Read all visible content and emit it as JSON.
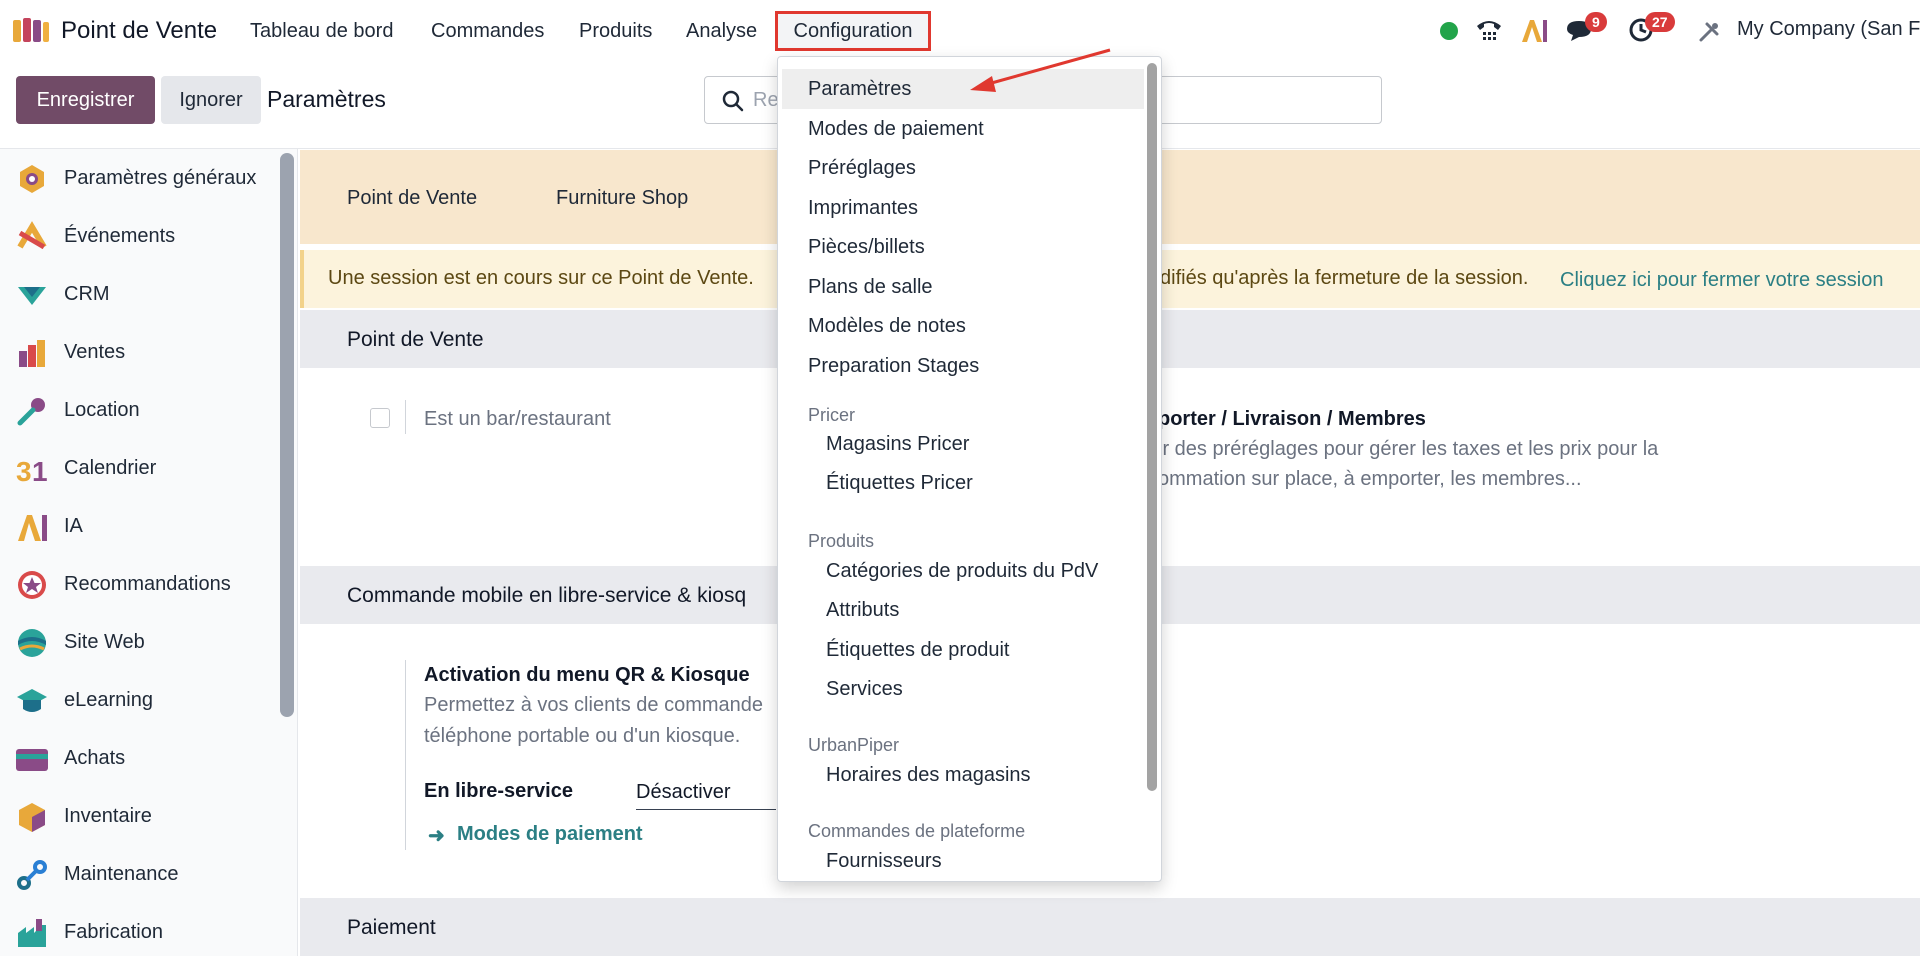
{
  "topbar": {
    "app_name": "Point de Vente",
    "menu": [
      "Tableau de bord",
      "Commandes",
      "Produits",
      "Analyse"
    ],
    "config_label": "Configuration",
    "messages_badge": "9",
    "activities_badge": "27",
    "company": "My Company (San F"
  },
  "control": {
    "save_label": "Enregistrer",
    "ignore_label": "Ignorer",
    "breadcrumb": "Paramètres",
    "search_placeholder": "Re"
  },
  "sidebar": {
    "items": [
      {
        "label": "Paramètres généraux",
        "icon": "general-settings-icon"
      },
      {
        "label": "Événements",
        "icon": "events-icon"
      },
      {
        "label": "CRM",
        "icon": "crm-icon"
      },
      {
        "label": "Ventes",
        "icon": "sales-icon"
      },
      {
        "label": "Location",
        "icon": "rental-icon"
      },
      {
        "label": "Calendrier",
        "icon": "calendar-icon"
      },
      {
        "label": "IA",
        "icon": "ai-icon"
      },
      {
        "label": "Recommandations",
        "icon": "recommendations-icon"
      },
      {
        "label": "Site Web",
        "icon": "website-icon"
      },
      {
        "label": "eLearning",
        "icon": "elearning-icon"
      },
      {
        "label": "Achats",
        "icon": "purchase-icon"
      },
      {
        "label": "Inventaire",
        "icon": "inventory-icon"
      },
      {
        "label": "Maintenance",
        "icon": "maintenance-icon"
      },
      {
        "label": "Fabrication",
        "icon": "manufacturing-icon"
      }
    ]
  },
  "main": {
    "tabs": [
      "Point de Vente",
      "Furniture Shop"
    ],
    "warning_left": "Une session est en cours sur ce Point de Vente.",
    "warning_right": "difiés qu'après la fermeture de la session.",
    "warning_link": "Cliquez ici pour fermer votre session",
    "section_pos": "Point de Vente",
    "restaurant_label": "Est un bar/restaurant",
    "takeaway_title": "porter / Livraison / Membres",
    "takeaway_desc1": "ir des préréglages pour gérer les taxes et les prix pour la",
    "takeaway_desc2": "ommation sur place, à emporter, les membres...",
    "section_mobile": "Commande mobile en libre-service & kiosq",
    "qr_title": "Activation du menu QR & Kiosque",
    "qr_desc1": "Permettez à vos clients de commande",
    "qr_desc2": "téléphone portable ou d'un kiosque.",
    "self_service_label": "En libre-service",
    "self_service_value": "Désactiver",
    "payment_methods_link": "Modes de paiement",
    "section_payment": "Paiement"
  },
  "dropdown": {
    "items": [
      "Paramètres",
      "Modes de paiement",
      "Préréglages",
      "Imprimantes",
      "Pièces/billets",
      "Plans de salle",
      "Modèles de notes",
      "Preparation Stages"
    ],
    "pricer_header": "Pricer",
    "pricer_items": [
      "Magasins Pricer",
      "Étiquettes Pricer"
    ],
    "products_header": "Produits",
    "products_items": [
      "Catégories de produits du PdV",
      "Attributs",
      "Étiquettes de produit",
      "Services"
    ],
    "urbanpiper_header": "UrbanPiper",
    "urbanpiper_items": [
      "Horaires des magasins"
    ],
    "platform_header": "Commandes de plateforme",
    "platform_items": [
      "Fournisseurs"
    ]
  }
}
